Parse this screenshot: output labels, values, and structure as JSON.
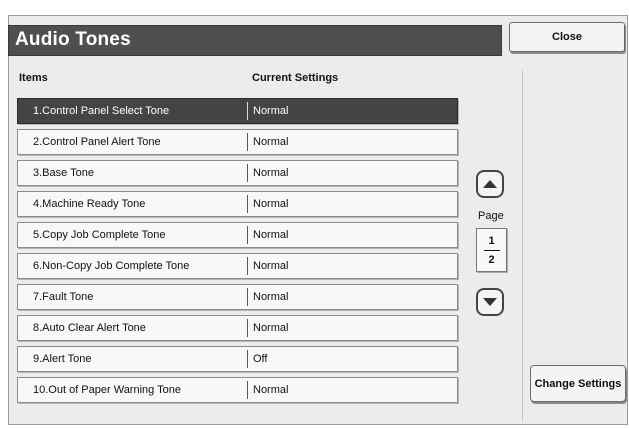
{
  "title": "Audio Tones",
  "close_label": "Close",
  "headers": {
    "items": "Items",
    "current": "Current Settings"
  },
  "rows": [
    {
      "item": "1.Control Panel Select Tone",
      "value": "Normal"
    },
    {
      "item": "2.Control Panel Alert Tone",
      "value": "Normal"
    },
    {
      "item": "3.Base Tone",
      "value": "Normal"
    },
    {
      "item": "4.Machine Ready Tone",
      "value": "Normal"
    },
    {
      "item": "5.Copy Job Complete Tone",
      "value": "Normal"
    },
    {
      "item": "6.Non-Copy Job Complete Tone",
      "value": "Normal"
    },
    {
      "item": "7.Fault Tone",
      "value": "Normal"
    },
    {
      "item": "8.Auto Clear Alert Tone",
      "value": "Normal"
    },
    {
      "item": "9.Alert Tone",
      "value": "Off"
    },
    {
      "item": "10.Out of Paper Warning Tone",
      "value": "Normal"
    }
  ],
  "selected_row": 0,
  "pager": {
    "label": "Page",
    "current": "1",
    "total": "2"
  },
  "icons": {
    "up": "up-arrow-icon",
    "down": "down-arrow-icon"
  },
  "change_settings_label": "Change Settings"
}
